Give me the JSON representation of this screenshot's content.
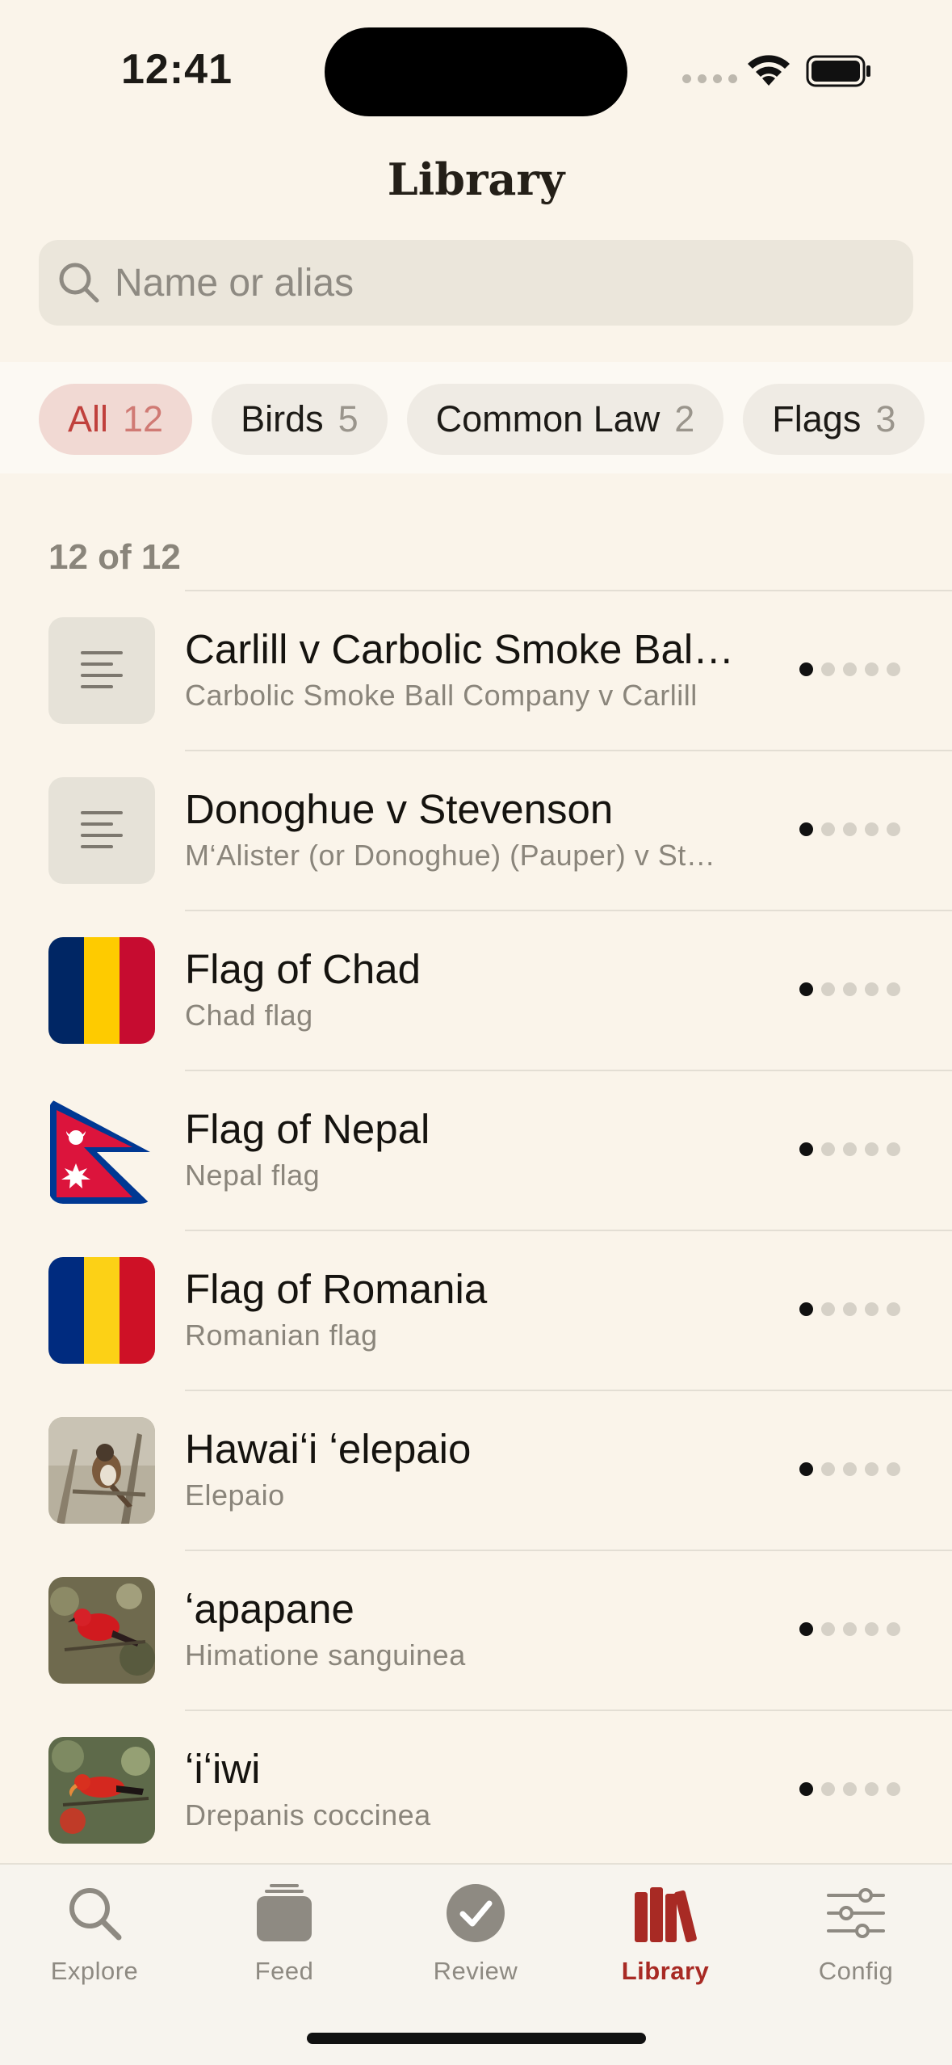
{
  "status": {
    "time": "12:41"
  },
  "header": {
    "title": "Library"
  },
  "search": {
    "placeholder": "Name or alias"
  },
  "filters": [
    {
      "label": "All",
      "count": "12",
      "active": true
    },
    {
      "label": "Birds",
      "count": "5"
    },
    {
      "label": "Common Law",
      "count": "2"
    },
    {
      "label": "Flags",
      "count": "3"
    }
  ],
  "results": {
    "count_label": "12 of 12"
  },
  "items": [
    {
      "title": "Carlill v Carbolic Smoke Bal…",
      "subtitle": "Carbolic Smoke Ball Company v Carlill",
      "thumb": "text-icon",
      "progress_level": 1,
      "progress_max": 5
    },
    {
      "title": "Donoghue v Stevenson",
      "subtitle": "M‘Alister (or Donoghue) (Pauper) v St…",
      "thumb": "text-icon",
      "progress_level": 1,
      "progress_max": 5
    },
    {
      "title": "Flag of Chad",
      "subtitle": "Chad flag",
      "thumb": "flag-chad",
      "progress_level": 1,
      "progress_max": 5
    },
    {
      "title": "Flag of Nepal",
      "subtitle": "Nepal flag",
      "thumb": "flag-nepal",
      "progress_level": 1,
      "progress_max": 5
    },
    {
      "title": "Flag of Romania",
      "subtitle": "Romanian flag",
      "thumb": "flag-romania",
      "progress_level": 1,
      "progress_max": 5
    },
    {
      "title": "Hawaiʻi ʻelepaio",
      "subtitle": "Elepaio",
      "thumb": "bird-photo-brown",
      "progress_level": 1,
      "progress_max": 5
    },
    {
      "title": "ʻapapane",
      "subtitle": "Himatione sanguinea",
      "thumb": "bird-photo-red",
      "progress_level": 1,
      "progress_max": 5
    },
    {
      "title": "ʻiʻiwi",
      "subtitle": "Drepanis coccinea",
      "thumb": "bird-photo-red-orange",
      "progress_level": 1,
      "progress_max": 5
    }
  ],
  "tabs": [
    {
      "label": "Explore",
      "icon": "search-icon"
    },
    {
      "label": "Feed",
      "icon": "stack-icon"
    },
    {
      "label": "Review",
      "icon": "checkmark-circle-icon"
    },
    {
      "label": "Library",
      "icon": "books-icon",
      "active": true
    },
    {
      "label": "Config",
      "icon": "sliders-icon"
    }
  ],
  "colors": {
    "background": "#faf4ea",
    "accent": "#a82a24",
    "chip_active_bg": "#f1d9d3"
  }
}
